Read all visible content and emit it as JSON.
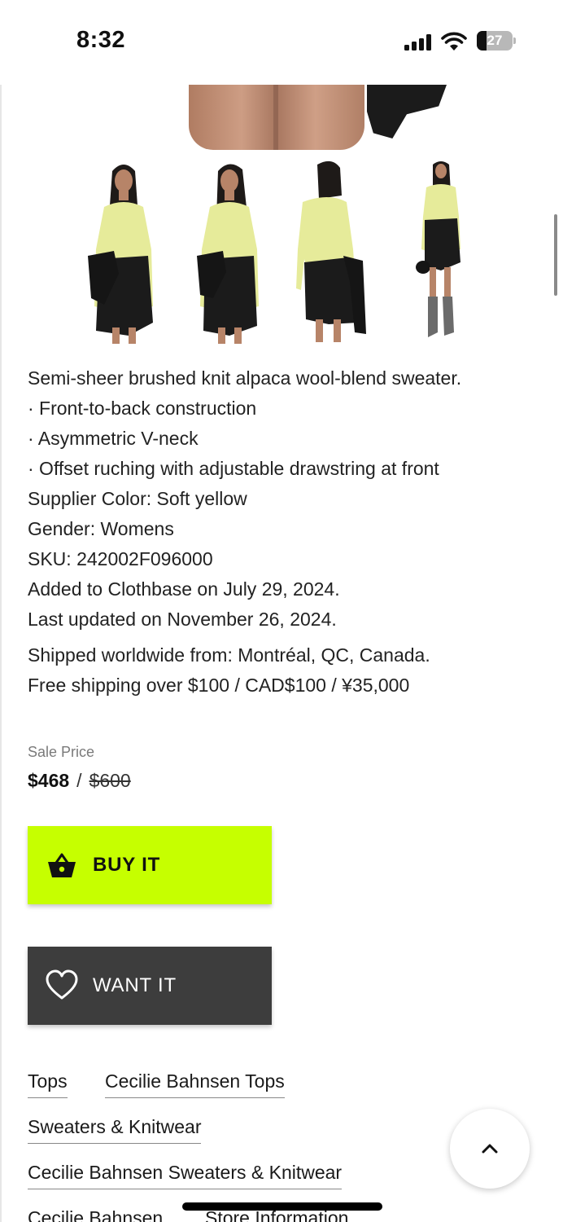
{
  "status_bar": {
    "time": "8:32",
    "battery": "27",
    "battery_level": 0.27,
    "icons": [
      "signal-icon",
      "wifi-icon",
      "battery-icon"
    ]
  },
  "product": {
    "description": [
      "Semi-sheer brushed knit alpaca wool-blend sweater.",
      "· Front-to-back construction",
      "· Asymmetric V-neck",
      "· Offset ruching with adjustable drawstring at front",
      "Supplier Color: Soft yellow",
      "Gender: Womens",
      "SKU: 242002F096000",
      "Added to Clothbase on July 29, 2024.",
      "Last updated on November 26, 2024."
    ],
    "shipping": [
      "Shipped worldwide from: Montréal, QC, Canada.",
      "Free shipping over $100 / CAD$100 / ¥35,000"
    ]
  },
  "price": {
    "label": "Sale Price",
    "current": "$468",
    "separator": "/",
    "original": "$600"
  },
  "buttons": {
    "buy": "BUY IT",
    "want": "WANT IT",
    "buy_icon": "basket-icon",
    "want_icon": "heart-icon"
  },
  "categories": [
    "Tops",
    "Cecilie Bahnsen Tops",
    "Sweaters & Knitwear",
    "Cecilie Bahnsen Sweaters & Knitwear",
    "Cecilie Bahnsen",
    "Store Information"
  ],
  "colors": {
    "buy_button": "#c6ff00",
    "want_button": "#3d3d3d",
    "sweater": "#e6eb9a",
    "skirt": "#1b1b1b"
  }
}
